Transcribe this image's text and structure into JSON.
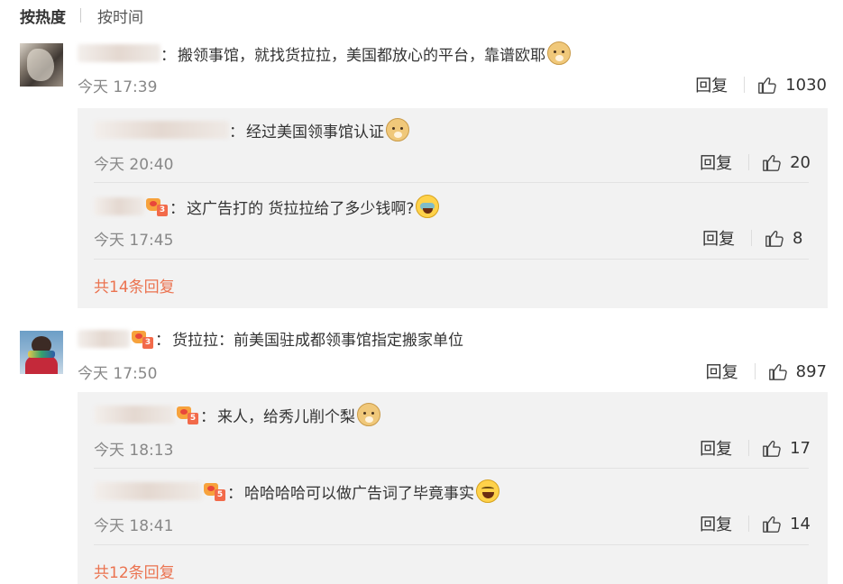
{
  "sort": {
    "hot": "按热度",
    "time": "按时间"
  },
  "comments": [
    {
      "text": "搬领事馆，就找货拉拉，美国都放心的平台，靠谱欧耶",
      "time": "今天 17:39",
      "reply_label": "回复",
      "likes": "1030",
      "emoji": "doge",
      "replies": [
        {
          "text": "经过美国领事馆认证",
          "time": "今天 20:40",
          "reply_label": "回复",
          "likes": "20",
          "emoji": "doge"
        },
        {
          "text": "这广告打的 货拉拉给了多少钱啊?",
          "time": "今天 17:45",
          "reply_label": "回复",
          "likes": "8",
          "emoji": "laugh-cry"
        }
      ],
      "more_replies": "共14条回复"
    },
    {
      "text": "货拉拉：前美国驻成都领事馆指定搬家单位",
      "time": "今天 17:50",
      "reply_label": "回复",
      "likes": "897",
      "replies": [
        {
          "text": "来人，给秀儿削个梨",
          "time": "今天 18:13",
          "reply_label": "回复",
          "likes": "17",
          "emoji": "doge"
        },
        {
          "text": "哈哈哈哈可以做广告词了毕竟事实",
          "time": "今天 18:41",
          "reply_label": "回复",
          "likes": "14",
          "emoji": "laugh"
        }
      ],
      "more_replies": "共12条回复"
    }
  ],
  "icons": {
    "like": "thumb-up-icon",
    "vip": "crown-badge-icon"
  },
  "colors": {
    "more_link": "#eb7350",
    "time": "#888888",
    "panel": "#f2f2f2"
  }
}
